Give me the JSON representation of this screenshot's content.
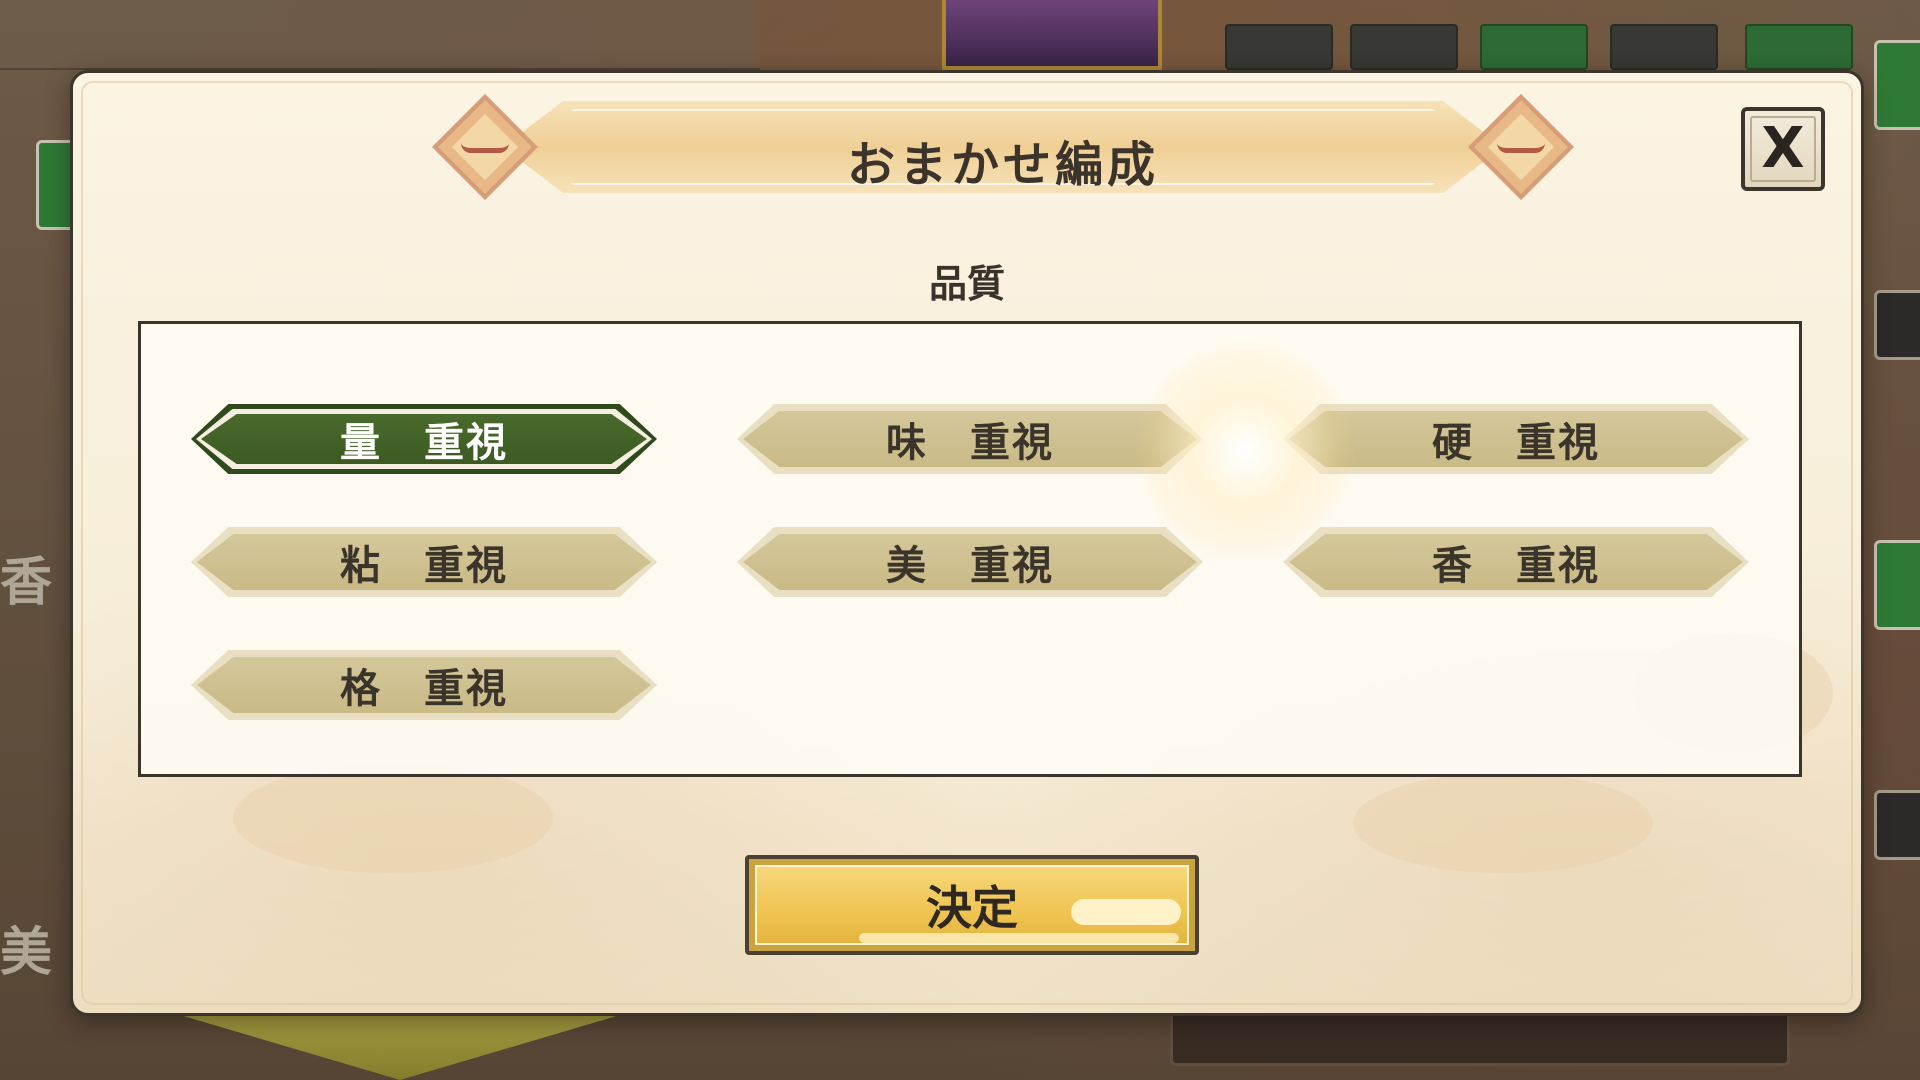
{
  "dialog": {
    "title": "おまかせ編成",
    "close_icon": "X",
    "section_label": "品質",
    "confirm_label": "決定"
  },
  "options": [
    {
      "label": "量　重視",
      "selected": true
    },
    {
      "label": "味　重視",
      "selected": false
    },
    {
      "label": "硬　重視",
      "selected": false
    },
    {
      "label": "粘　重視",
      "selected": false
    },
    {
      "label": "美　重視",
      "selected": false
    },
    {
      "label": "香　重視",
      "selected": false
    },
    {
      "label": "格　重視",
      "selected": false
    }
  ],
  "background": {
    "side_kanji_1": "香",
    "side_kanji_2": "美"
  },
  "colors": {
    "selected_option": "#3c5a22",
    "unselected_option": "#c9ba86",
    "confirm_button": "#efc451",
    "dialog_background": "#f6ecd6"
  }
}
